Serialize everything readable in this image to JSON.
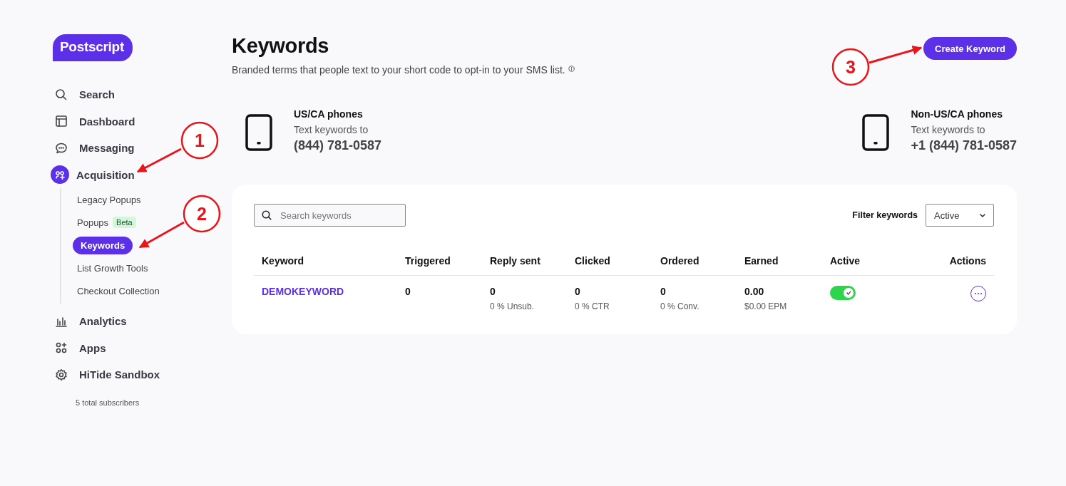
{
  "logo": "Postscript",
  "sidebar": {
    "items": [
      {
        "label": "Search",
        "selected": false
      },
      {
        "label": "Dashboard",
        "selected": false
      },
      {
        "label": "Messaging",
        "selected": false
      },
      {
        "label": "Acquisition",
        "selected": true,
        "children": [
          {
            "label": "Legacy Popups",
            "selected": false
          },
          {
            "label": "Popups",
            "badge": "Beta",
            "selected": false
          },
          {
            "label": "Keywords",
            "selected": true
          },
          {
            "label": "List Growth Tools",
            "selected": false
          },
          {
            "label": "Checkout Collection",
            "selected": false
          }
        ]
      },
      {
        "label": "Analytics",
        "selected": false
      },
      {
        "label": "Apps",
        "selected": false
      },
      {
        "label": "HiTide Sandbox",
        "selected": false
      }
    ],
    "subscribers": "5 total subscribers"
  },
  "page": {
    "title": "Keywords",
    "subtitle": "Branded terms that people text to your short code to opt-in to your SMS list.",
    "create_button": "Create Keyword"
  },
  "phones": [
    {
      "heading": "US/CA phones",
      "caption": "Text keywords to",
      "number": "(844) 781-0587"
    },
    {
      "heading": "Non-US/CA phones",
      "caption": "Text keywords to",
      "number": "+1 (844) 781-0587"
    }
  ],
  "table_card": {
    "search": {
      "placeholder": "Search keywords"
    },
    "filter": {
      "label": "Filter keywords",
      "value": "Active"
    },
    "columns": [
      "Keyword",
      "Triggered",
      "Reply sent",
      "Clicked",
      "Ordered",
      "Earned",
      "Active",
      "Actions"
    ],
    "rows": [
      {
        "keyword": "DEMOKEYWORD",
        "triggered": "0",
        "reply_sent": "0",
        "reply_sub": "0 % Unsub.",
        "clicked": "0",
        "clicked_sub": "0 % CTR",
        "ordered": "0",
        "ordered_sub": "0 % Conv.",
        "earned": "0.00",
        "earned_sub": "$0.00 EPM",
        "active": true
      }
    ]
  },
  "annotations": [
    {
      "label": "1"
    },
    {
      "label": "2"
    },
    {
      "label": "3"
    }
  ]
}
